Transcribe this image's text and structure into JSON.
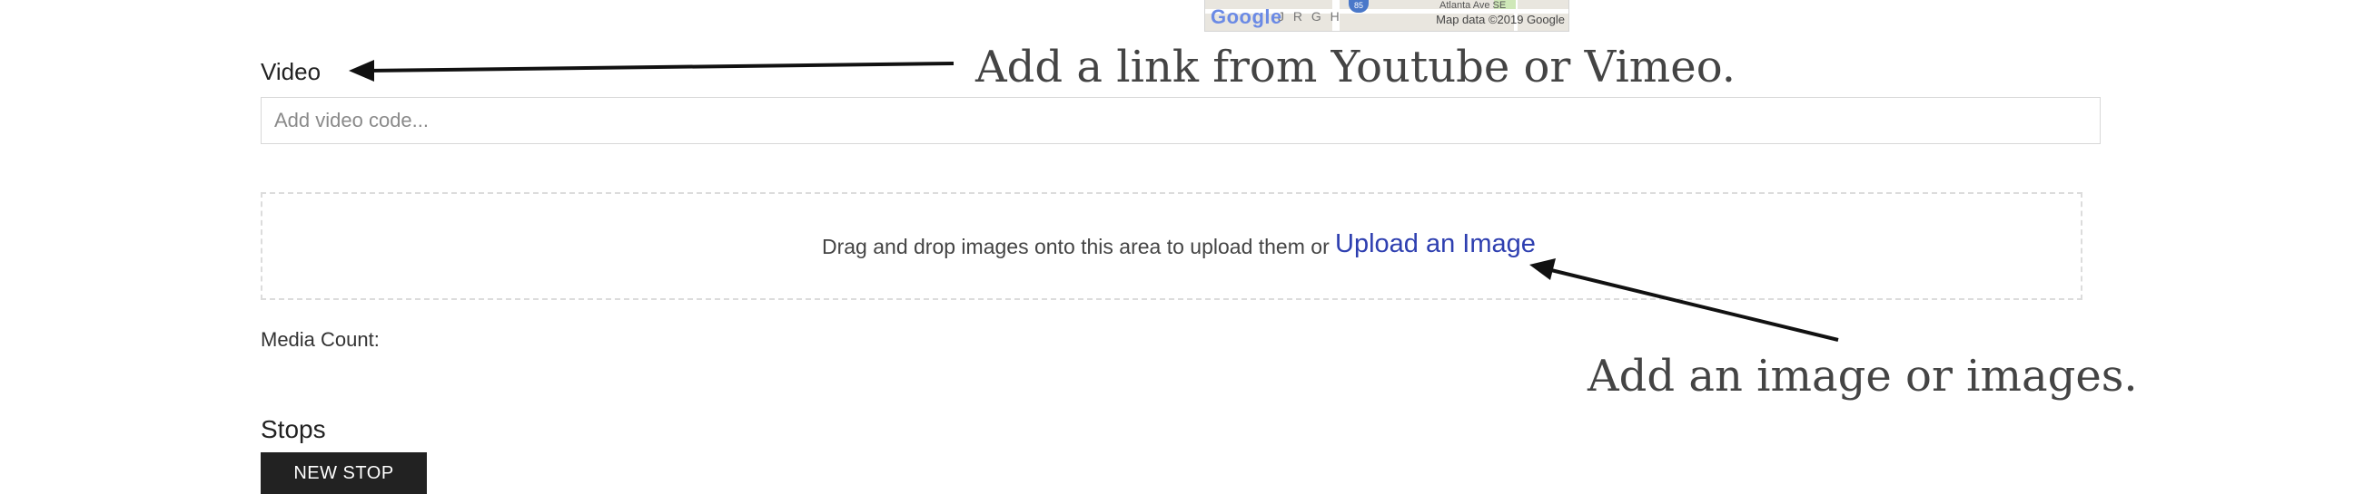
{
  "map": {
    "brand": "Google",
    "letters": "J R G H",
    "street": "Atlanta Ave SE",
    "shield": "85",
    "copyright": "Map data ©2019 Google"
  },
  "video": {
    "label": "Video",
    "placeholder": "Add video code...",
    "value": ""
  },
  "upload": {
    "instruction": "Drag and drop images onto this area to upload them or",
    "link_label": "Upload an Image"
  },
  "media": {
    "count_label": "Media Count:",
    "count_value": ""
  },
  "stops": {
    "heading": "Stops",
    "new_button": "NEW STOP"
  },
  "annotations": {
    "video_callout": "Add a link from Youtube or Vimeo.",
    "image_callout": "Add an image or images."
  },
  "colors": {
    "link": "#2e3fb0",
    "button_bg": "#222222",
    "annotation_text": "#444444"
  }
}
